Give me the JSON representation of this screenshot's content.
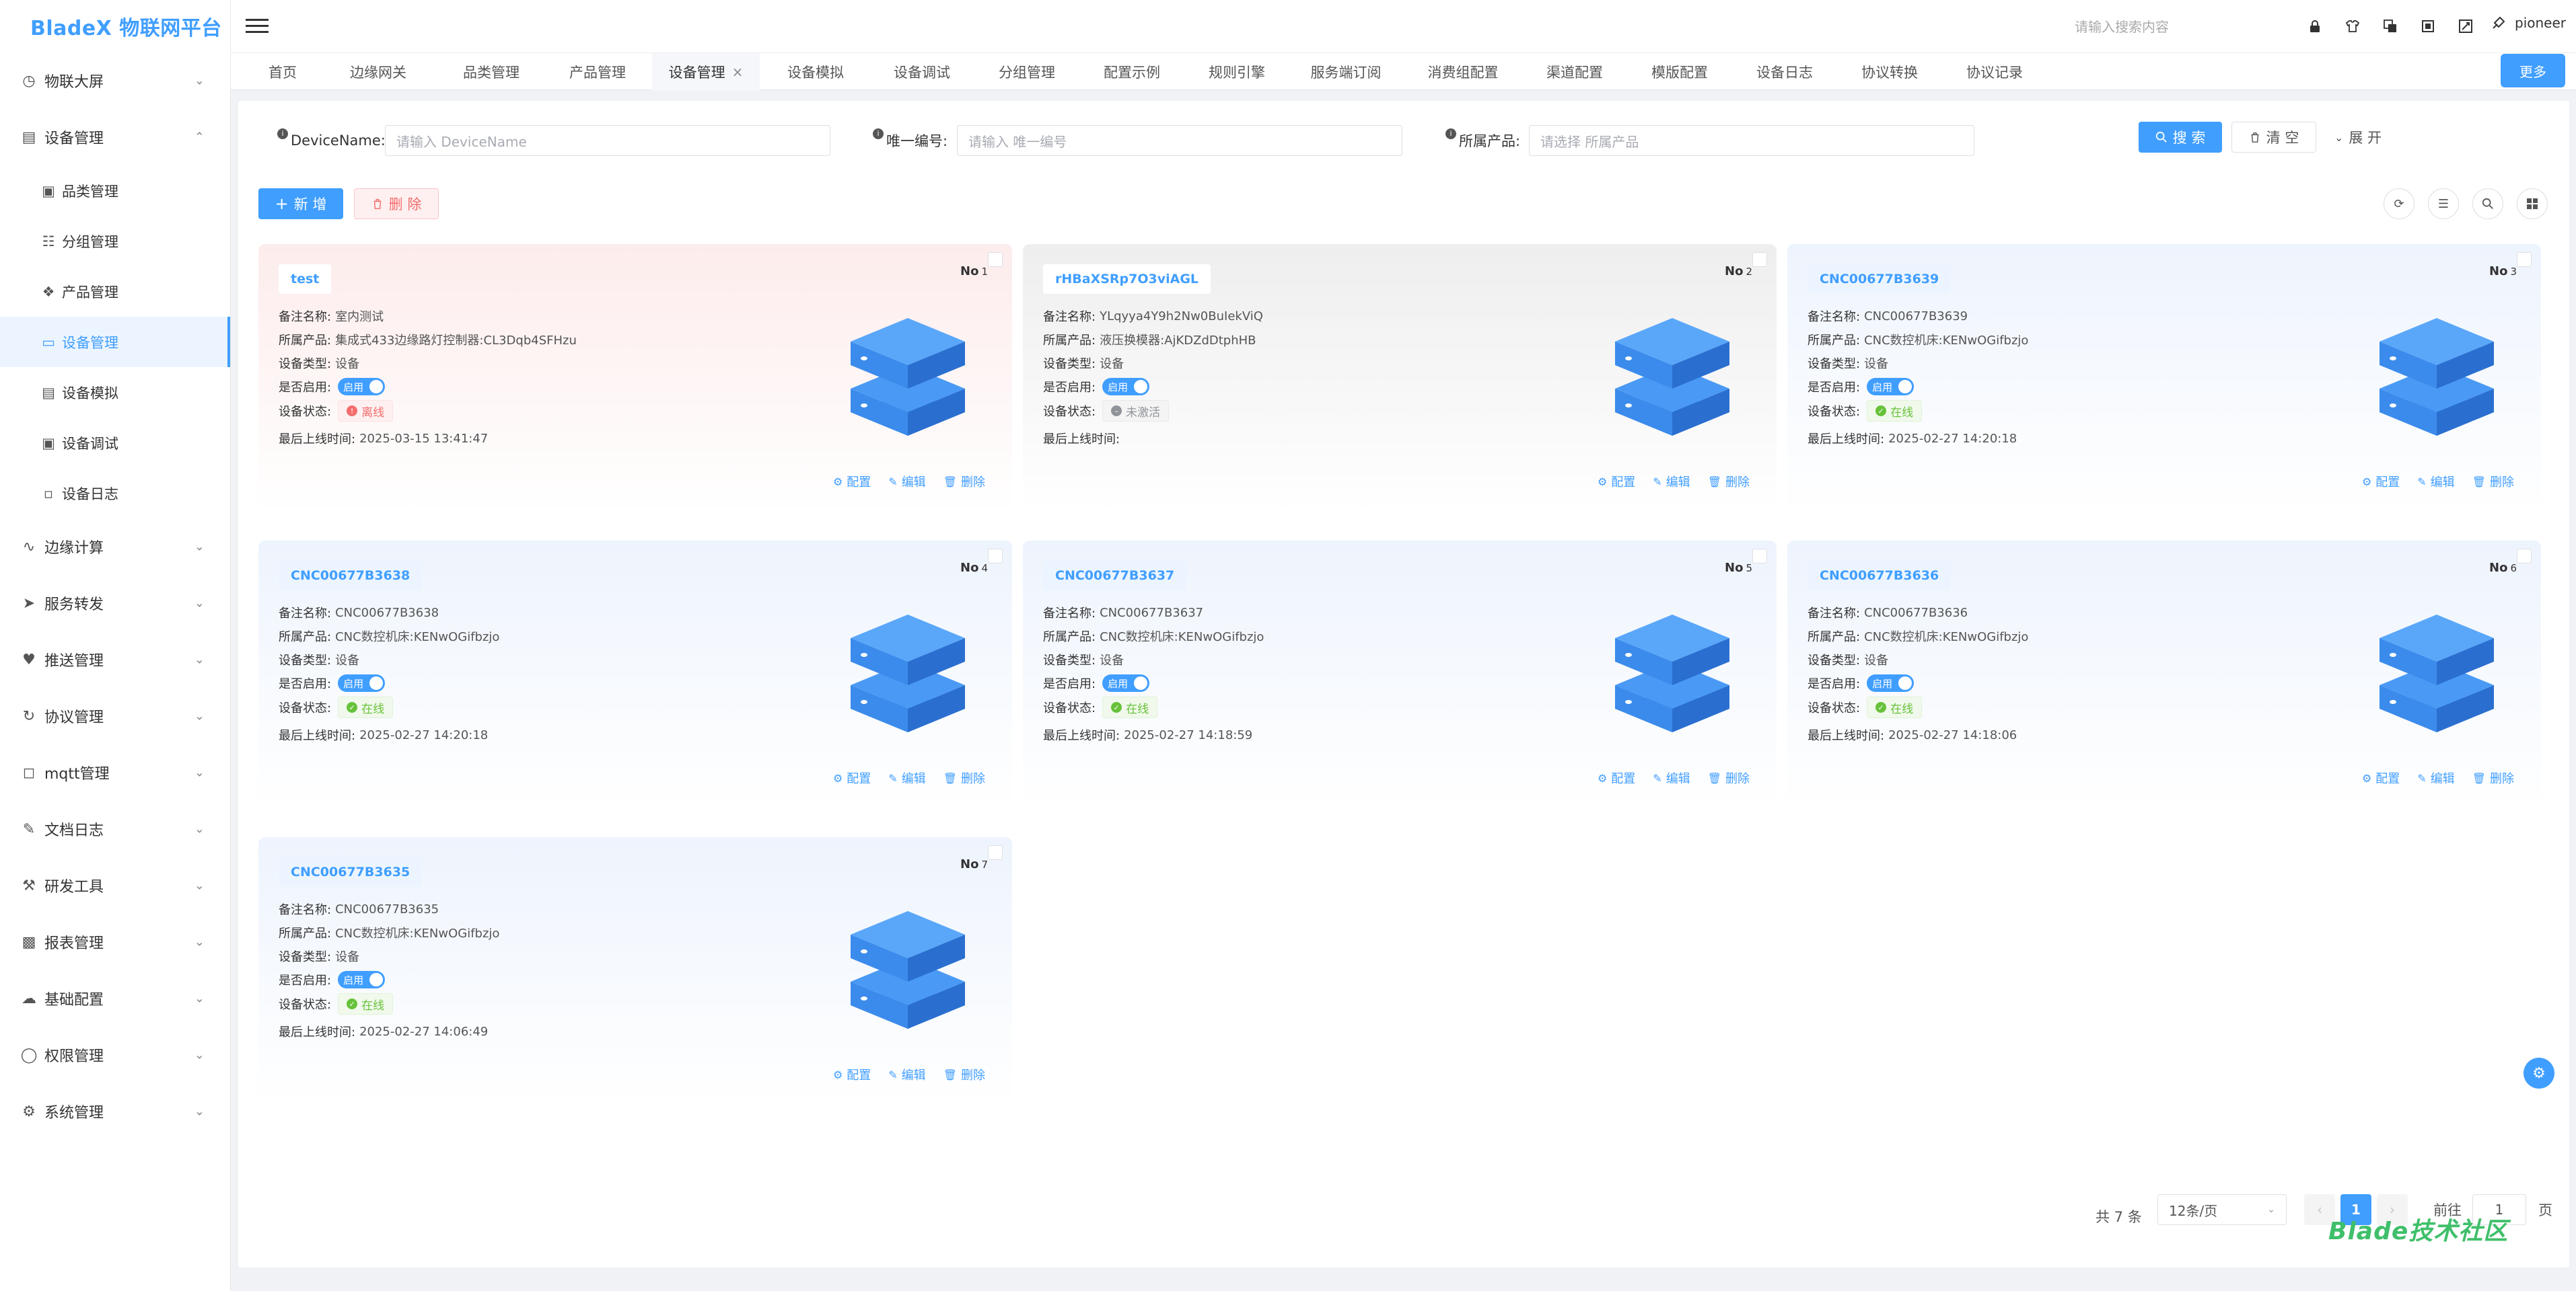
{
  "app": {
    "logo": "BladeX 物联网平台",
    "search_placeholder": "请输入搜索内容",
    "username": "pioneer"
  },
  "sidebar": {
    "items": [
      {
        "label": "物联大屏",
        "icon": "dashboard-icon"
      },
      {
        "label": "设备管理",
        "icon": "device-icon",
        "expanded": true
      },
      {
        "label": "边缘计算",
        "icon": "edge-icon"
      },
      {
        "label": "服务转发",
        "icon": "forward-icon"
      },
      {
        "label": "推送管理",
        "icon": "bell-icon"
      },
      {
        "label": "协议管理",
        "icon": "protocol-icon"
      },
      {
        "label": "mqtt管理",
        "icon": "mqtt-icon"
      },
      {
        "label": "文档日志",
        "icon": "doc-icon"
      },
      {
        "label": "研发工具",
        "icon": "tool-icon"
      },
      {
        "label": "报表管理",
        "icon": "report-icon"
      },
      {
        "label": "基础配置",
        "icon": "config-icon"
      },
      {
        "label": "权限管理",
        "icon": "permission-icon"
      },
      {
        "label": "系统管理",
        "icon": "system-icon"
      }
    ],
    "sub_items": [
      {
        "label": "品类管理",
        "icon": "category-icon"
      },
      {
        "label": "分组管理",
        "icon": "group-icon"
      },
      {
        "label": "产品管理",
        "icon": "product-icon"
      },
      {
        "label": "设备管理",
        "icon": "monitor-icon",
        "active": true
      },
      {
        "label": "设备模拟",
        "icon": "simulate-icon"
      },
      {
        "label": "设备调试",
        "icon": "debug-icon"
      },
      {
        "label": "设备日志",
        "icon": "log-icon"
      }
    ]
  },
  "tabs": [
    "首页",
    "边缘网关",
    "品类管理",
    "产品管理",
    "设备管理",
    "设备模拟",
    "设备调试",
    "分组管理",
    "配置示例",
    "规则引擎",
    "服务端订阅",
    "消费组配置",
    "渠道配置",
    "模版配置",
    "设备日志",
    "协议转换",
    "协议记录"
  ],
  "tabs_more": "更多",
  "query": {
    "device_name_label": "DeviceName:",
    "device_name_placeholder": "请输入 DeviceName",
    "unique_label": "唯一编号:",
    "unique_placeholder": "请输入 唯一编号",
    "product_label": "所属产品:",
    "product_placeholder": "请选择 所属产品",
    "search_btn": "搜 索",
    "clear_btn": "清 空",
    "expand_btn": "展 开"
  },
  "toolbar": {
    "add_btn": "新 增",
    "delete_btn": "删 除"
  },
  "card_labels": {
    "remark": "备注名称:",
    "product": "所属产品:",
    "type": "设备类型:",
    "enabled": "是否启用:",
    "status": "设备状态:",
    "last_online": "最后上线时间:",
    "switch_text": "启用",
    "no_prefix": "No",
    "act_config": "配置",
    "act_edit": "编辑",
    "act_delete": "删除"
  },
  "devices": [
    {
      "no": "1",
      "name": "test",
      "remark": "室内测试",
      "product": "集成式433边缘路灯控制器:CL3Dqb4SFHzu",
      "type": "设备",
      "status": "离线",
      "status_kind": "offline",
      "last_online": "2025-03-15 13:41:47",
      "theme": "pink"
    },
    {
      "no": "2",
      "name": "rHBaXSRp7O3viAGL",
      "remark": "YLqyya4Y9h2Nw0BuIekViQ",
      "product": "液压换模器:AjKDZdDtphHB",
      "type": "设备",
      "status": "未激活",
      "status_kind": "inactive",
      "last_online": "",
      "theme": "gray"
    },
    {
      "no": "3",
      "name": "CNC00677B3639",
      "remark": "CNC00677B3639",
      "product": "CNC数控机床:KENwOGifbzjo",
      "type": "设备",
      "status": "在线",
      "status_kind": "online",
      "last_online": "2025-02-27 14:20:18",
      "theme": "blue"
    },
    {
      "no": "4",
      "name": "CNC00677B3638",
      "remark": "CNC00677B3638",
      "product": "CNC数控机床:KENwOGifbzjo",
      "type": "设备",
      "status": "在线",
      "status_kind": "online",
      "last_online": "2025-02-27 14:20:18",
      "theme": "blue"
    },
    {
      "no": "5",
      "name": "CNC00677B3637",
      "remark": "CNC00677B3637",
      "product": "CNC数控机床:KENwOGifbzjo",
      "type": "设备",
      "status": "在线",
      "status_kind": "online",
      "last_online": "2025-02-27 14:18:59",
      "theme": "blue"
    },
    {
      "no": "6",
      "name": "CNC00677B3636",
      "remark": "CNC00677B3636",
      "product": "CNC数控机床:KENwOGifbzjo",
      "type": "设备",
      "status": "在线",
      "status_kind": "online",
      "last_online": "2025-02-27 14:18:06",
      "theme": "blue"
    },
    {
      "no": "7",
      "name": "CNC00677B3635",
      "remark": "CNC00677B3635",
      "product": "CNC数控机床:KENwOGifbzjo",
      "type": "设备",
      "status": "在线",
      "status_kind": "online",
      "last_online": "2025-02-27 14:06:49",
      "theme": "blue"
    }
  ],
  "pagination": {
    "total": "共 7 条",
    "page_size": "12条/页",
    "current": "1",
    "goto_label": "前往",
    "goto_value": "1",
    "page_suffix": "页"
  },
  "watermark": "Blade技术社区",
  "colors": {
    "primary": "#409eff",
    "online": "#67c23a",
    "offline": "#f56c6c",
    "inactive": "#909399"
  }
}
